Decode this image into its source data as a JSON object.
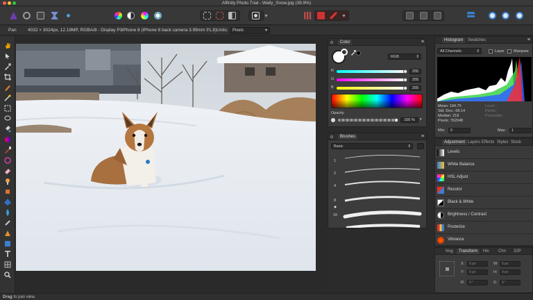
{
  "window": {
    "title": "Affinity Photo Trial - Wally_Snow.jpg (39.9%)"
  },
  "context": {
    "tool": "Pan",
    "image_info": "4032 × 3024px, 12.19MP, RGBA/8 - Display P3",
    "camera": "iPhone 8 (iPhone 8 back camera 3.99mm f/1.8)",
    "units_label": "Units:",
    "units_value": "Pixels"
  },
  "color_panel": {
    "tab": "Color",
    "mode": "RGB",
    "r_label": "R",
    "g_label": "G",
    "b_label": "B",
    "r_value": "255",
    "g_value": "255",
    "b_value": "255",
    "opacity_label": "Opacity",
    "opacity_value": "100 %"
  },
  "brushes_panel": {
    "tab": "Brushes",
    "category": "Basic",
    "sizes": [
      "1",
      "2",
      "4",
      "8",
      "16"
    ]
  },
  "histogram_panel": {
    "tabs": [
      "Histogram",
      "Swatches"
    ],
    "channel": "All Channels",
    "layer_label": "Layer",
    "marquee_label": "Marquee",
    "mean": "Mean: 194.75",
    "std_dev": "Std. Dev.: 68.14",
    "median": "Median: 218",
    "pixels": "Pixels: 762048",
    "level": "Level: -",
    "pixels_right": "Pixels: -",
    "percentile": "Percentile: -",
    "min_label": "Min:",
    "min_value": "0",
    "max_label": "Max:",
    "max_value": "1"
  },
  "adjustment_panel": {
    "tabs": [
      "Adjustment",
      "Layers",
      "Effects",
      "Styles",
      "Stock"
    ],
    "items": [
      {
        "label": "Levels",
        "icon": "levels-icon"
      },
      {
        "label": "White Balance",
        "icon": "white-balance-icon"
      },
      {
        "label": "HSL Adjust",
        "icon": "hsl-icon"
      },
      {
        "label": "Recolor",
        "icon": "recolor-icon"
      },
      {
        "label": "Black & White",
        "icon": "black-white-icon"
      },
      {
        "label": "Brightness / Contrast",
        "icon": "brightness-contrast-icon"
      },
      {
        "label": "Posterize",
        "icon": "posterize-icon"
      },
      {
        "label": "Vibrance",
        "icon": "vibrance-icon"
      }
    ]
  },
  "transform_panel": {
    "tabs": [
      "Nvg",
      "Transform",
      "His",
      "Chn",
      "32P"
    ],
    "x_label": "X:",
    "y_label": "Y:",
    "w_label": "W:",
    "h_label": "H:",
    "r_label": "R:",
    "s_label": "S:",
    "x_value": "0 px",
    "y_value": "0 px",
    "w_value": "0 px",
    "h_value": "0 px",
    "r_value": "0 °",
    "s_value": "0 °"
  },
  "status": {
    "drag_label": "Drag",
    "message": "to pan view."
  },
  "colors": {
    "accent": "#2f6fd0",
    "panel_bg": "#3c3c3c"
  }
}
